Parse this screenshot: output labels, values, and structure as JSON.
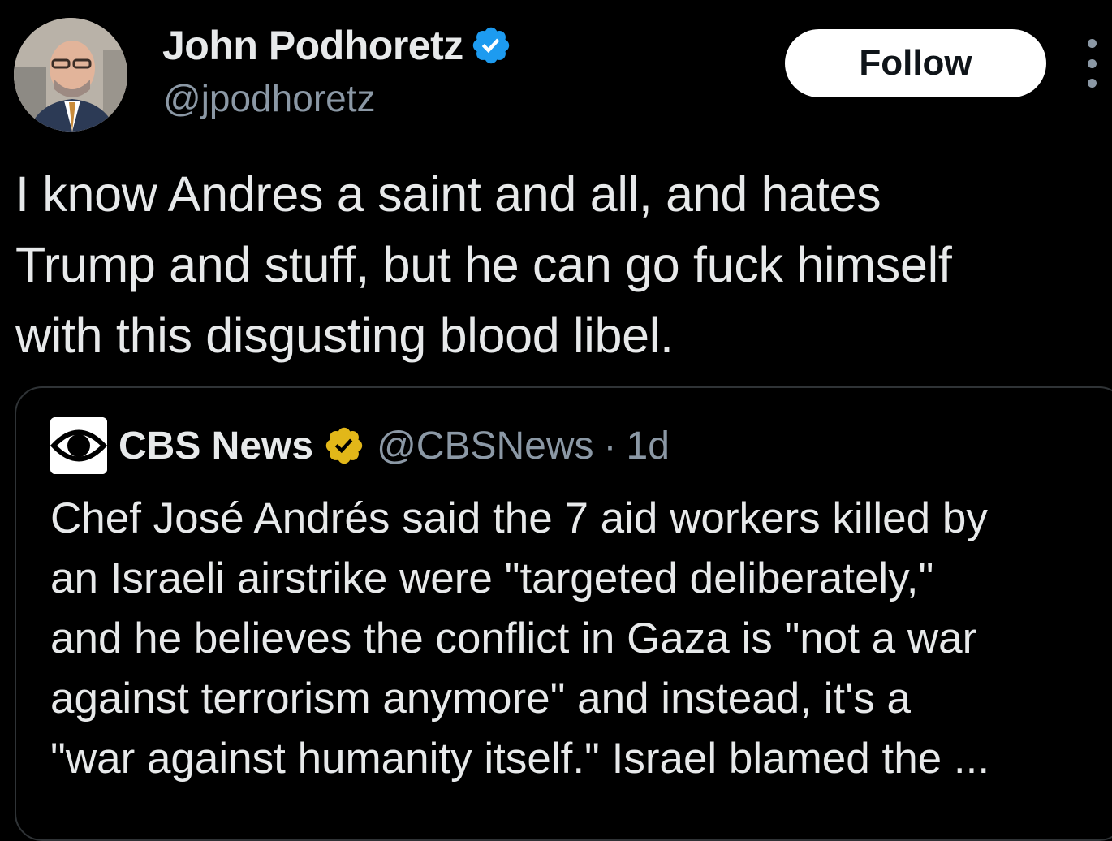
{
  "tweet": {
    "author_name": "John Podhoretz",
    "author_handle": "@jpodhoretz",
    "verified_color": "#1d9bf0",
    "follow_label": "Follow",
    "text": "I know Andres a saint and all, and hates\nTrump and stuff, but he can go fuck himself\nwith this disgusting blood libel."
  },
  "quoted_tweet": {
    "author_name": "CBS News",
    "author_handle": "@CBSNews",
    "separator": "·",
    "time": "1d",
    "badge_color": "#e2b719",
    "text": "Chef José Andrés said the 7 aid workers killed by\nan Israeli airstrike were \"targeted deliberately,\"\nand he believes the conflict in Gaza is \"not a war\nagainst terrorism anymore\" and instead, it's a\n\"war against humanity itself.\" Israel blamed the ..."
  },
  "icons": {
    "avatar": "avatar-photo",
    "verified": "verified-check-icon",
    "more": "more-dots-icon",
    "cbs_logo": "cbs-eye-logo",
    "gold_badge": "gold-verified-icon"
  },
  "colors": {
    "background": "#000000",
    "text_primary": "#e7e9ea",
    "text_secondary": "#8b98a5",
    "border": "#2f3336",
    "follow_bg": "#ffffff"
  }
}
